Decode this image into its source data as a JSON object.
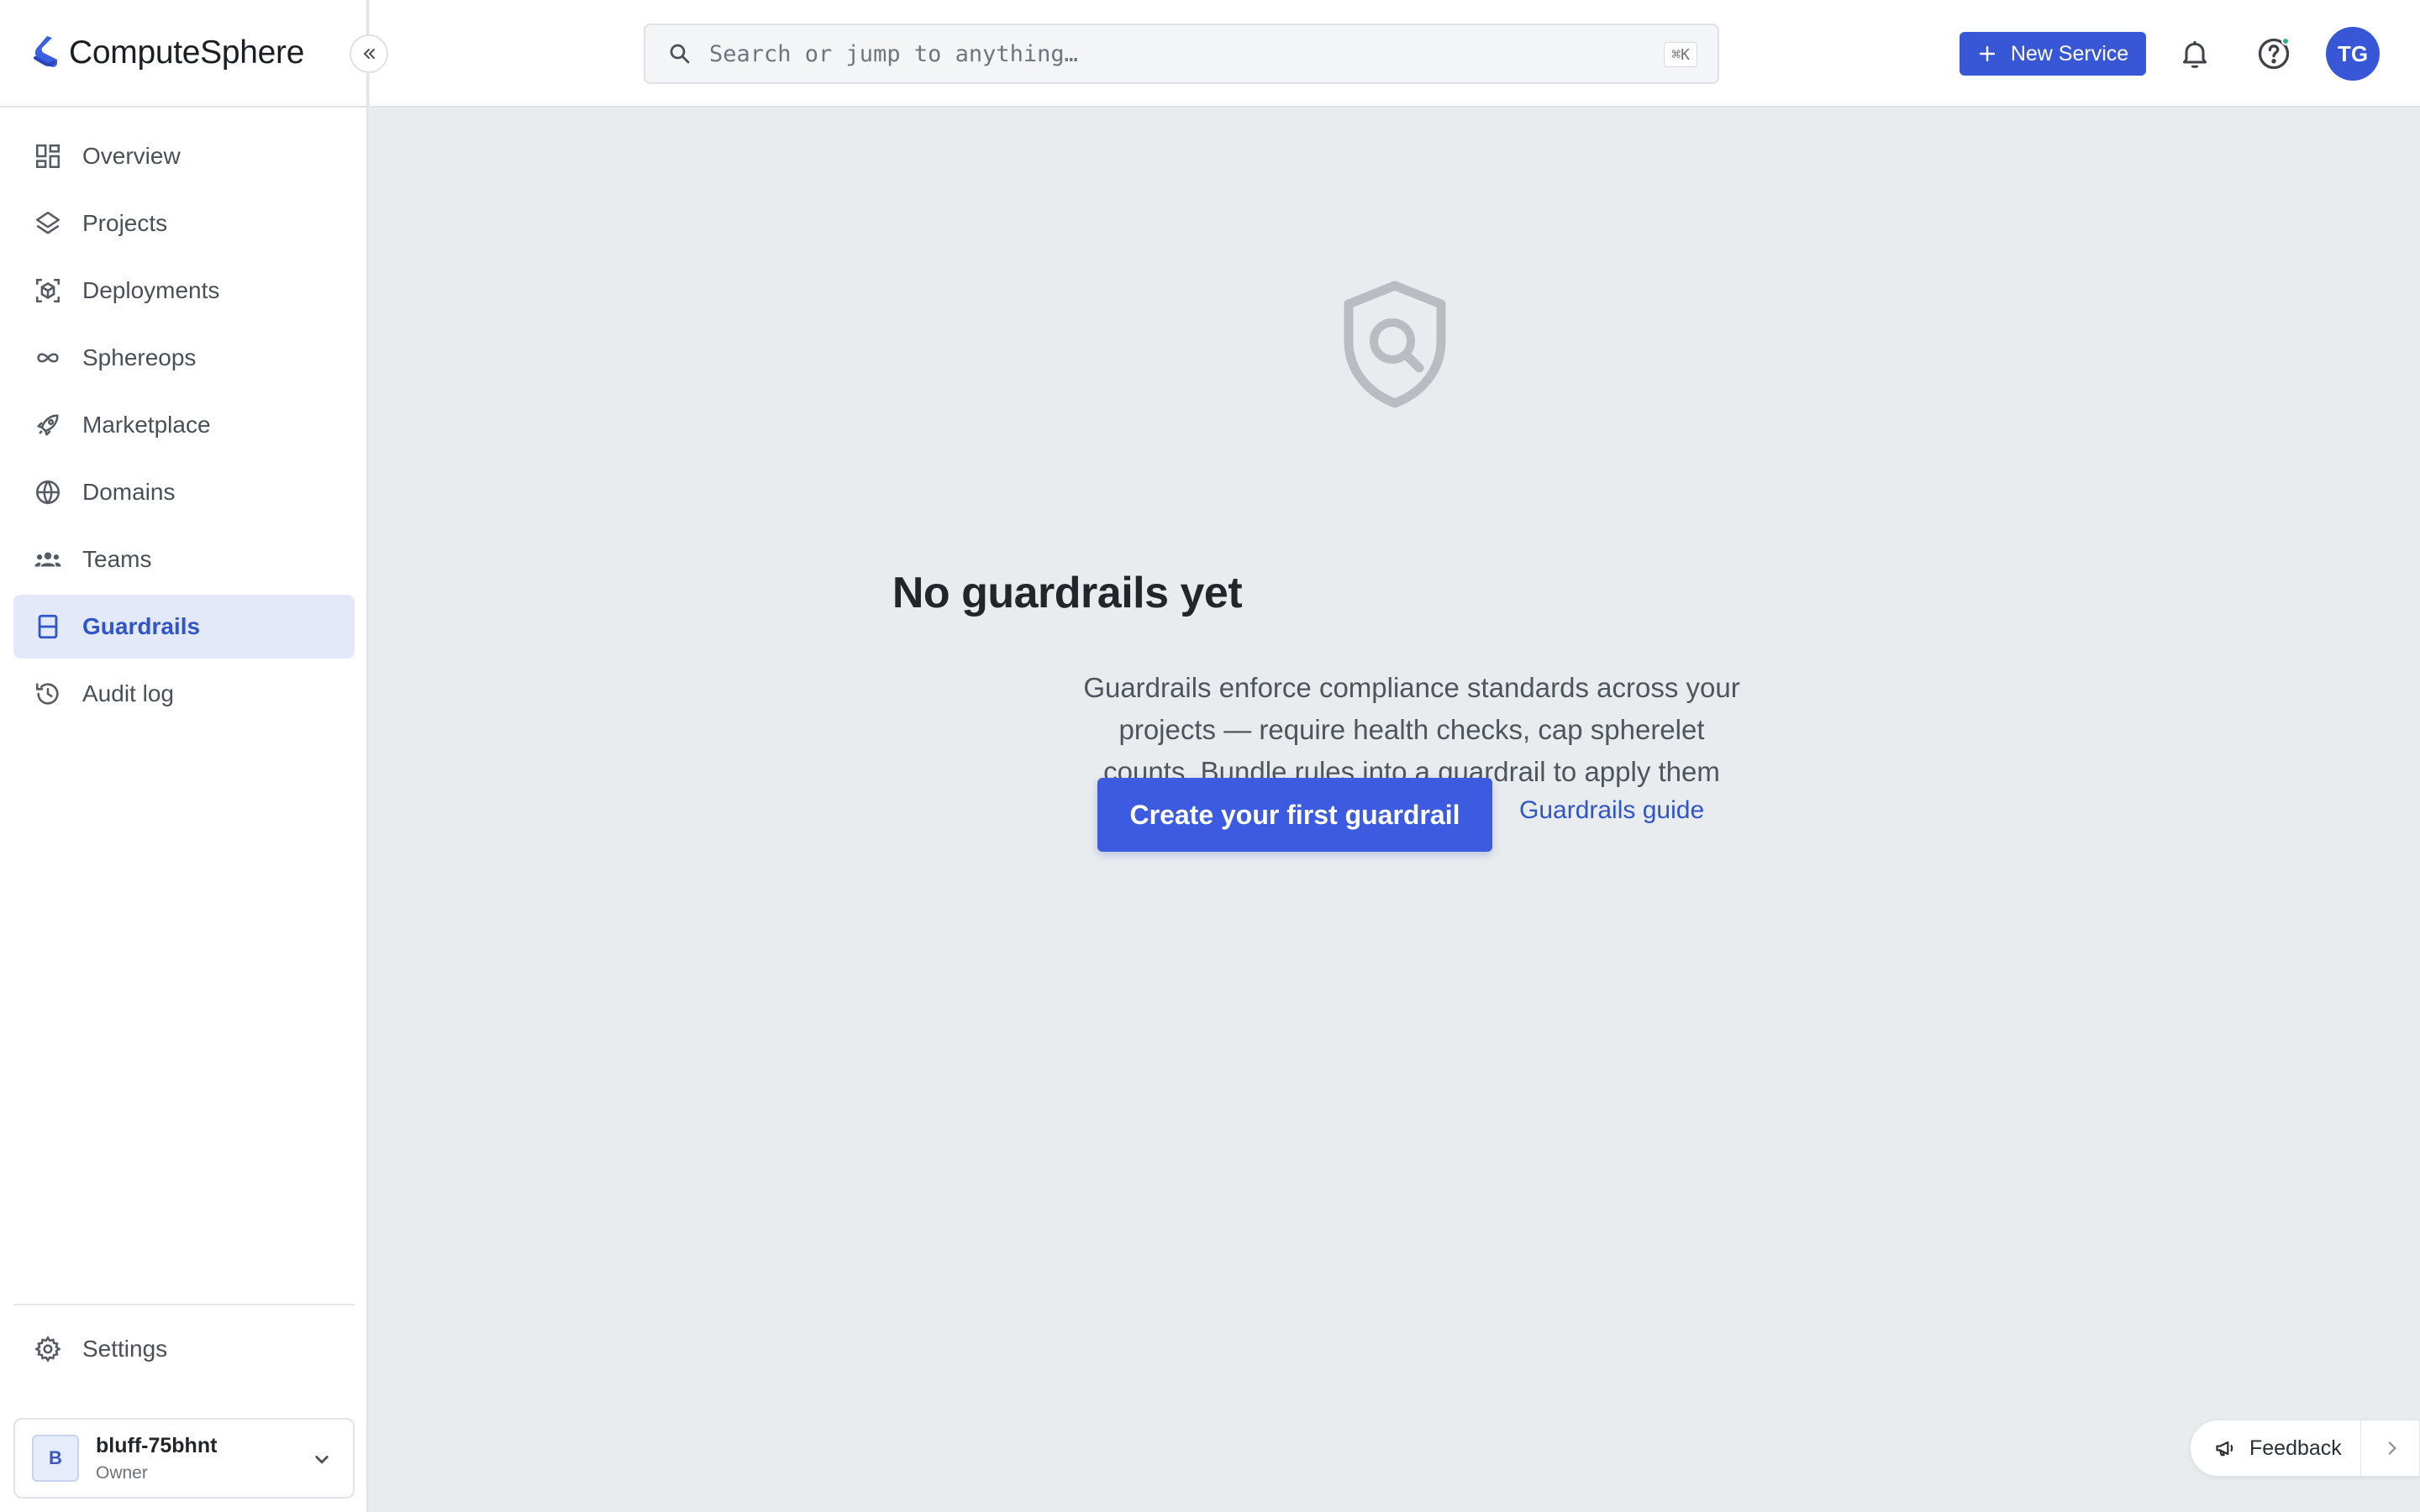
{
  "app": {
    "name": "ComputeSphere"
  },
  "search": {
    "placeholder": "Search or jump to anything…",
    "shortcut": "⌘K"
  },
  "header": {
    "new_service_label": "New Service",
    "avatar_initials": "TG"
  },
  "sidebar": {
    "items": [
      {
        "label": "Overview",
        "icon": "grid-icon",
        "active": false
      },
      {
        "label": "Projects",
        "icon": "layers-icon",
        "active": false
      },
      {
        "label": "Deployments",
        "icon": "box-icon",
        "active": false
      },
      {
        "label": "Sphereops",
        "icon": "infinity-icon",
        "active": false
      },
      {
        "label": "Marketplace",
        "icon": "rocket-icon",
        "active": false
      },
      {
        "label": "Domains",
        "icon": "globe-icon",
        "active": false
      },
      {
        "label": "Teams",
        "icon": "team-icon",
        "active": false
      },
      {
        "label": "Guardrails",
        "icon": "guardrail-icon",
        "active": true
      },
      {
        "label": "Audit log",
        "icon": "history-icon",
        "active": false
      }
    ],
    "settings_label": "Settings"
  },
  "account": {
    "badge": "B",
    "name": "bluff-75bhnt",
    "role": "Owner"
  },
  "empty_state": {
    "title": "No guardrails yet",
    "description": "Guardrails enforce compliance standards across your projects — require health checks, cap spherelet counts. Bundle rules into a guardrail to apply them together.",
    "primary_action": "Create your first guardrail",
    "secondary_action": "Guardrails guide"
  },
  "feedback": {
    "label": "Feedback"
  },
  "colors": {
    "accent": "#3857d6",
    "active_bg": "#e3e9f8",
    "page_bg": "#e9ecef"
  }
}
